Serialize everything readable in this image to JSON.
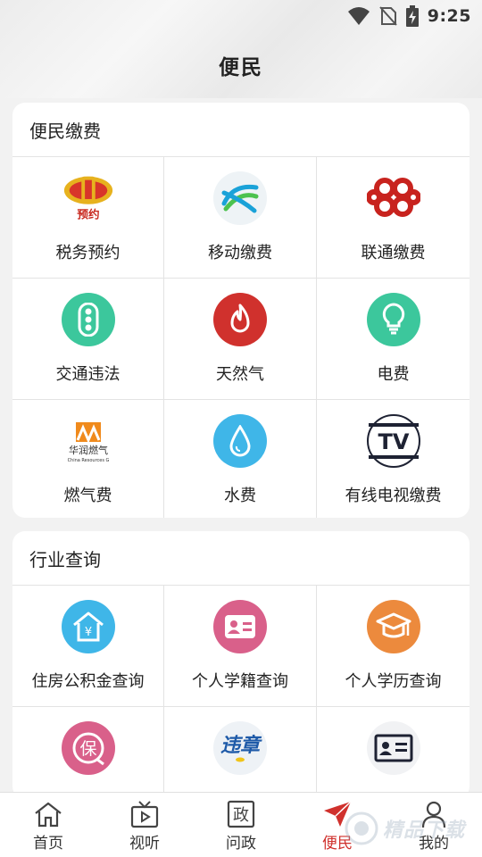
{
  "status_bar": {
    "time": "9:25",
    "icons": [
      "wifi-icon",
      "no-sim-icon",
      "battery-charging-icon"
    ]
  },
  "page_title": "便民",
  "sections": [
    {
      "title": "便民缴费",
      "items": [
        {
          "label": "税务预约",
          "icon": "tax-emblem-icon",
          "icon_text": "预约"
        },
        {
          "label": "移动缴费",
          "icon": "china-mobile-icon"
        },
        {
          "label": "联通缴费",
          "icon": "china-unicom-icon"
        },
        {
          "label": "交通违法",
          "icon": "traffic-light-icon",
          "color": "#3cc79c"
        },
        {
          "label": "天然气",
          "icon": "flame-icon",
          "color": "#d0312d"
        },
        {
          "label": "电费",
          "icon": "lightbulb-icon",
          "color": "#3cc79c"
        },
        {
          "label": "燃气费",
          "icon": "china-resources-gas-icon",
          "icon_text": "华润燃气",
          "icon_subtext": "China Resources G"
        },
        {
          "label": "水费",
          "icon": "water-drop-icon",
          "color": "#3fb6e8"
        },
        {
          "label": "有线电视缴费",
          "icon": "tv-icon",
          "icon_text": "TV"
        }
      ]
    },
    {
      "title": "行业查询",
      "items": [
        {
          "label": "住房公积金查询",
          "icon": "housing-fund-icon",
          "color": "#3fb6e8"
        },
        {
          "label": "个人学籍查询",
          "icon": "student-id-icon",
          "color": "#d9608a"
        },
        {
          "label": "个人学历查询",
          "icon": "graduation-cap-icon",
          "color": "#ec8a3d"
        },
        {
          "label": "",
          "icon": "insurance-icon",
          "icon_text": "保",
          "color": "#d9608a"
        },
        {
          "label": "",
          "icon": "violation-icon",
          "icon_text": "违章"
        },
        {
          "label": "",
          "icon": "id-card-icon"
        }
      ]
    }
  ],
  "bottom_nav": [
    {
      "label": "首页",
      "icon": "home-icon"
    },
    {
      "label": "视听",
      "icon": "tv-play-icon"
    },
    {
      "label": "问政",
      "icon": "zheng-icon",
      "icon_text": "政"
    },
    {
      "label": "便民",
      "icon": "paper-plane-icon",
      "active": true
    },
    {
      "label": "我的",
      "icon": "user-icon"
    }
  ],
  "watermark": {
    "text": "精品下载"
  },
  "colors": {
    "accent": "#d0312d",
    "green": "#3cc79c",
    "blue": "#3fb6e8",
    "pink": "#d9608a",
    "orange": "#ec8a3d"
  }
}
